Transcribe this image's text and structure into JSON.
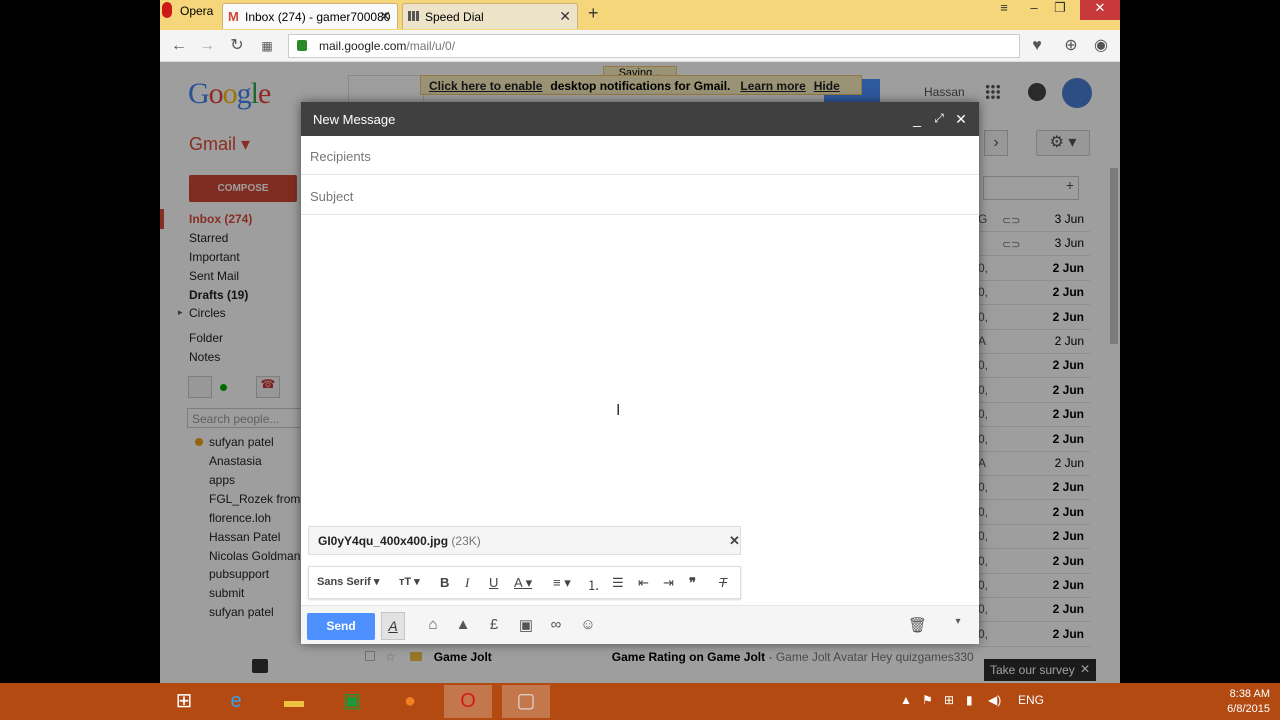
{
  "browser": {
    "menu_label": "Opera",
    "tabs": [
      {
        "label": "Inbox (274) - gamer700080"
      },
      {
        "label": "Speed Dial"
      }
    ],
    "new_tab": "+",
    "url_domain": "mail.google.com",
    "url_path": "/mail/u/0/"
  },
  "gmail": {
    "logo": "Google",
    "app_label": "Gmail ▾",
    "compose_label": "COMPOSE",
    "user_name": "Hassan",
    "saving": "Saving...",
    "notification": {
      "enable": "Click here to enable",
      "text": "desktop notifications for Gmail.",
      "learn_more": "Learn more",
      "hide": "Hide"
    },
    "nav": [
      {
        "label": "Inbox (274)"
      },
      {
        "label": "Starred"
      },
      {
        "label": "Important"
      },
      {
        "label": "Sent Mail"
      },
      {
        "label": "Drafts (19)"
      },
      {
        "label": "Circles"
      },
      {
        "label": "Folder"
      },
      {
        "label": "Notes"
      }
    ],
    "search_people_placeholder": "Search people...",
    "contacts": [
      "sufyan patel",
      "Anastasia",
      "apps",
      "FGL_Rozek from",
      "florence.loh",
      "Hassan Patel",
      "Nicolas Goldman",
      "pubsupport",
      "submit",
      "sufyan patel"
    ],
    "dates": [
      "3 Jun",
      "3 Jun",
      "2 Jun",
      "2 Jun",
      "2 Jun",
      "2 Jun",
      "2 Jun",
      "2 Jun",
      "2 Jun",
      "2 Jun",
      "2 Jun",
      "2 Jun",
      "2 Jun",
      "2 Jun",
      "2 Jun",
      "2 Jun",
      "2 Jun",
      "2 Jun"
    ],
    "snips": [
      "G",
      "",
      "0,",
      "0,",
      "0,",
      "A",
      "0,",
      "0,",
      "0,",
      "0,",
      "A",
      "0,",
      "0,",
      "0,",
      "0,",
      "0,",
      "0,",
      "0,"
    ],
    "bottom_row": {
      "sender": "Game Jolt",
      "subject": "Game Rating on Game Jolt",
      "snippet": "- Game Jolt Avatar Hey quizgames330"
    },
    "survey": "Take our survey"
  },
  "compose": {
    "title": "New Message",
    "recipients_placeholder": "Recipients",
    "subject_placeholder": "Subject",
    "attachment_name": "GI0yY4qu_400x400.jpg",
    "attachment_size": "(23K)",
    "font_label": "Sans Serif",
    "send_label": "Send"
  },
  "taskbar": {
    "language": "ENG",
    "time": "8:38 AM",
    "date": "6/8/2015"
  }
}
